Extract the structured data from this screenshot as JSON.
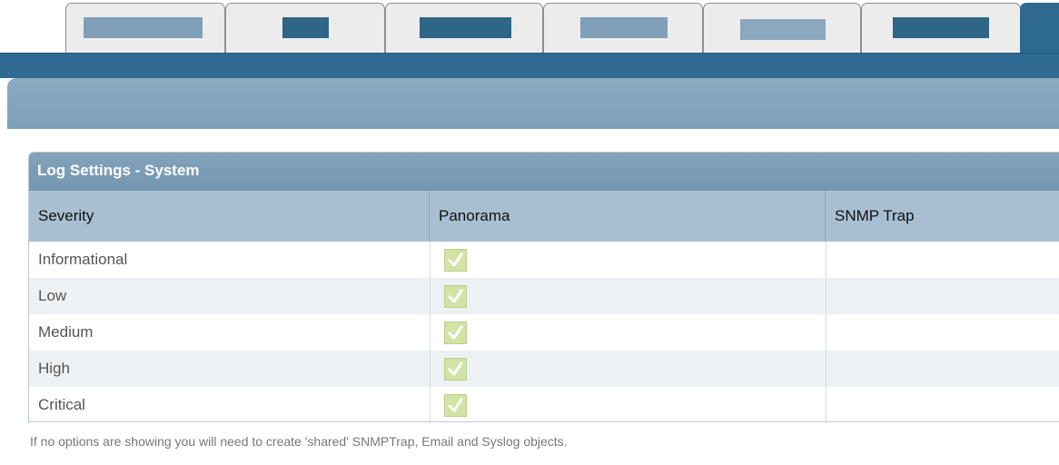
{
  "colors": {
    "tab_bg": "#ececec",
    "active_tab": "#2e6a90",
    "band": "#2f6b92",
    "header": "#82a3bc",
    "panel_title": "#7a9bb5",
    "column_header": "#a8bfd1",
    "check_fill": "#d2e3a5",
    "redacted_light": "#7f9fb9",
    "redacted_dark": "#2f6588"
  },
  "tabs": [
    {
      "label": "",
      "redacted": true
    },
    {
      "label": "",
      "redacted": true
    },
    {
      "label": "",
      "redacted": true
    },
    {
      "label": "",
      "redacted": true
    },
    {
      "label": "",
      "redacted": true
    },
    {
      "label": "",
      "redacted": true
    }
  ],
  "panel": {
    "title": "Log Settings - System",
    "columns": [
      "Severity",
      "Panorama",
      "SNMP Trap"
    ],
    "rows": [
      {
        "severity": "Informational",
        "panorama": true,
        "snmp_trap": ""
      },
      {
        "severity": "Low",
        "panorama": true,
        "snmp_trap": ""
      },
      {
        "severity": "Medium",
        "panorama": true,
        "snmp_trap": ""
      },
      {
        "severity": "High",
        "panorama": true,
        "snmp_trap": ""
      },
      {
        "severity": "Critical",
        "panorama": true,
        "snmp_trap": ""
      }
    ]
  },
  "icons": {
    "checkbox": "checkmark-icon"
  },
  "note": "If no options are showing you will need to create 'shared' SNMPTrap, Email and Syslog objects."
}
